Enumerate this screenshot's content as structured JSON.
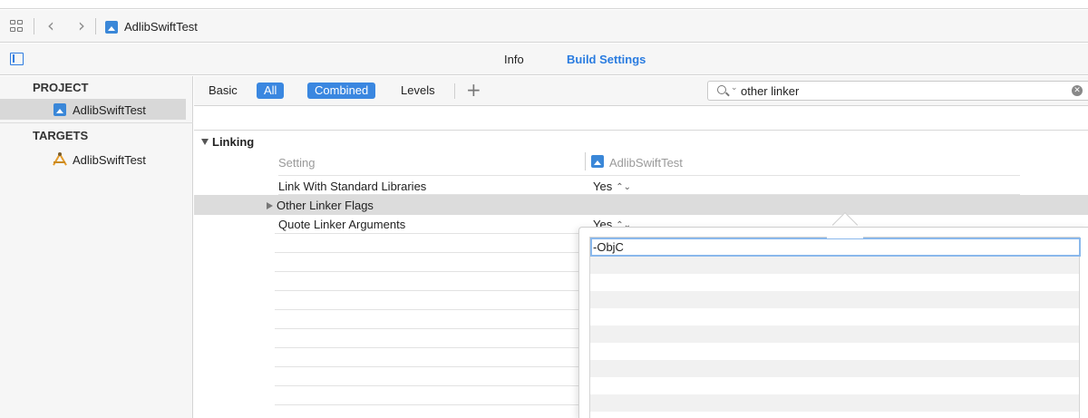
{
  "jumpbar": {
    "title": "AdlibSwiftTest"
  },
  "tabs": {
    "info": "Info",
    "build_settings": "Build Settings"
  },
  "sidebar": {
    "project_header": "PROJECT",
    "project_item": "AdlibSwiftTest",
    "targets_header": "TARGETS",
    "target_item": "AdlibSwiftTest"
  },
  "filter": {
    "basic": "Basic",
    "all": "All",
    "combined": "Combined",
    "levels": "Levels",
    "plus": "+",
    "search_value": "other linker"
  },
  "section": {
    "title": "Linking",
    "col_setting": "Setting",
    "col_target": "AdlibSwiftTest"
  },
  "rows": [
    {
      "label": "Link With Standard Libraries",
      "value": "Yes"
    },
    {
      "label": "Other Linker Flags",
      "value": ""
    },
    {
      "label": "Quote Linker Arguments",
      "value": "Yes"
    }
  ],
  "popover": {
    "entry": "-ObjC"
  },
  "colors": {
    "accent": "#2a7ce0",
    "pill": "#3a87e0",
    "selection": "#dcdcdc",
    "toolbar": "#f6f6f6"
  }
}
